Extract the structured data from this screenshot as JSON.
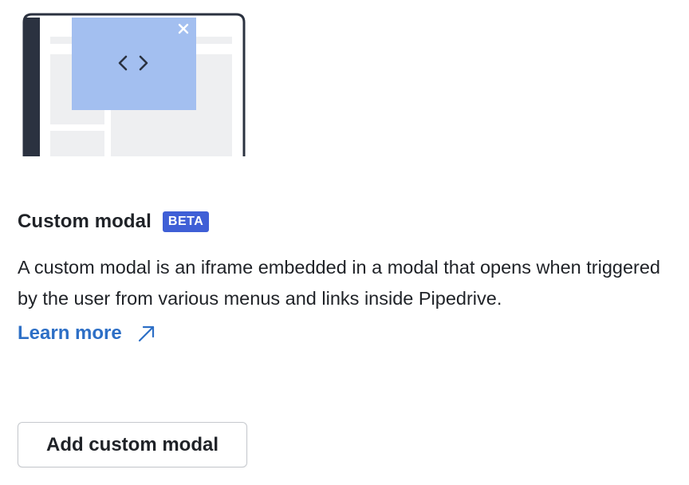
{
  "title": "Custom modal",
  "badge": "BETA",
  "description": "A custom modal is an iframe embedded in a modal that opens when triggered by the user from various menus and links inside Pipedrive.",
  "learn_more": {
    "label": "Learn more",
    "icon": "arrow-up-right-icon"
  },
  "add_button_label": "Add custom modal",
  "illustration": {
    "code_icon": "code-brackets-icon",
    "close_icon": "close-icon"
  },
  "colors": {
    "badge": "#3f5fd6",
    "link": "#2d6fc6",
    "modal_fill": "#a3bff0",
    "frame_dark": "#2b3240",
    "placeholder": "#eeeff1"
  }
}
